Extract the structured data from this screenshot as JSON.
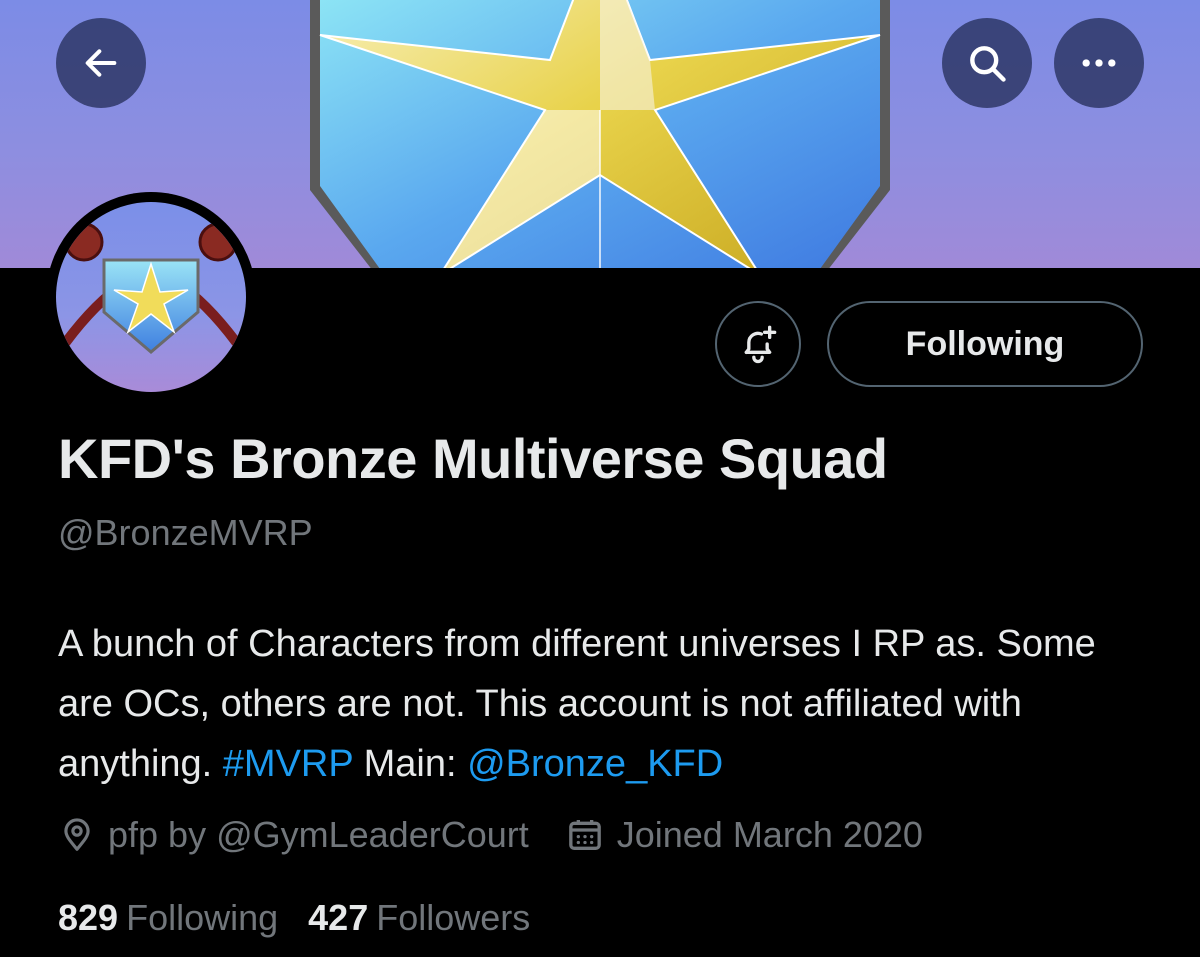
{
  "profile": {
    "display_name": "KFD's Bronze Multiverse Squad",
    "handle": "@BronzeMVRP",
    "bio": {
      "text": "A bunch of Characters from different universes I RP as. Some are OCs, others are not. This account is not affiliated with anything. ",
      "hashtag": "#MVRP",
      "main_label": " Main: ",
      "main_handle": "@Bronze_KFD"
    },
    "location": "pfp by @GymLeaderCourt",
    "joined": "Joined March 2020",
    "following_count": "829",
    "following_label": "Following",
    "followers_count": "427",
    "followers_label": "Followers"
  },
  "actions": {
    "following_button": "Following"
  },
  "icons": {
    "back": "arrow-left-icon",
    "search": "search-icon",
    "more": "more-icon",
    "notify": "bell-plus-icon",
    "location": "location-pin-icon",
    "calendar": "calendar-icon"
  },
  "colors": {
    "background": "#000000",
    "text": "#e7e9ea",
    "muted": "#71767b",
    "link": "#1d9bf0",
    "border": "#536471"
  }
}
